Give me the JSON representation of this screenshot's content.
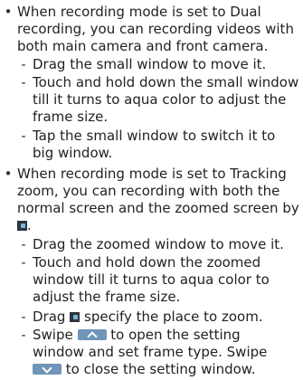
{
  "bullets": {
    "main": "•",
    "sub": "-"
  },
  "section1": {
    "intro": [
      "When recording mode is set to Dual",
      "recording, you can recording videos with",
      "both main camera and front camera."
    ],
    "item1": [
      "Drag the small window to move it."
    ],
    "item2": [
      "Touch and hold down the small window",
      "till it turns to aqua color to adjust the",
      "frame size."
    ],
    "item3": [
      "Tap the small window to switch it to",
      "big window."
    ]
  },
  "section2": {
    "intro": [
      "When recording mode is set to Tracking",
      "zoom, you can recording with both the",
      "normal screen and the zoomed screen by",
      "."
    ],
    "item1": [
      "Drag the zoomed window to move it."
    ],
    "item2": [
      "Touch and hold down the zoomed",
      "window till it turns to aqua color to",
      "adjust the frame size."
    ],
    "item3": {
      "before": "Drag",
      "after": "specify the place to zoom."
    },
    "item4": {
      "swipe": "Swipe",
      "after_up": "to open the setting",
      "line2": "window and set frame type. Swipe",
      "after_down": "to close the setting window."
    }
  },
  "icons": {
    "zoom_marker": "tracking-zoom-marker-icon",
    "swipe_up": "chevron-up-button-icon",
    "swipe_down": "chevron-down-button-icon",
    "swipe_button_color": "#6f95b8"
  }
}
